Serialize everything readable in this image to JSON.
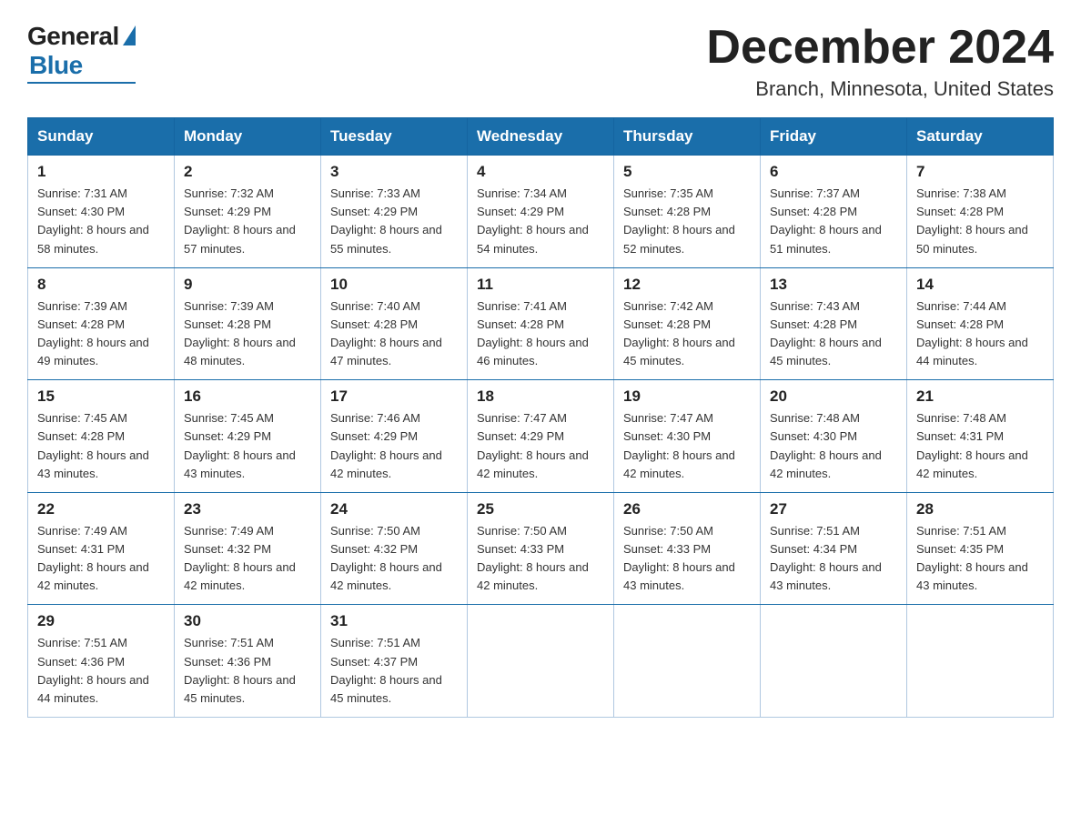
{
  "header": {
    "logo_general": "General",
    "logo_blue": "Blue",
    "month_title": "December 2024",
    "location": "Branch, Minnesota, United States"
  },
  "weekdays": [
    "Sunday",
    "Monday",
    "Tuesday",
    "Wednesday",
    "Thursday",
    "Friday",
    "Saturday"
  ],
  "weeks": [
    [
      {
        "day": "1",
        "sunrise": "Sunrise: 7:31 AM",
        "sunset": "Sunset: 4:30 PM",
        "daylight": "Daylight: 8 hours and 58 minutes."
      },
      {
        "day": "2",
        "sunrise": "Sunrise: 7:32 AM",
        "sunset": "Sunset: 4:29 PM",
        "daylight": "Daylight: 8 hours and 57 minutes."
      },
      {
        "day": "3",
        "sunrise": "Sunrise: 7:33 AM",
        "sunset": "Sunset: 4:29 PM",
        "daylight": "Daylight: 8 hours and 55 minutes."
      },
      {
        "day": "4",
        "sunrise": "Sunrise: 7:34 AM",
        "sunset": "Sunset: 4:29 PM",
        "daylight": "Daylight: 8 hours and 54 minutes."
      },
      {
        "day": "5",
        "sunrise": "Sunrise: 7:35 AM",
        "sunset": "Sunset: 4:28 PM",
        "daylight": "Daylight: 8 hours and 52 minutes."
      },
      {
        "day": "6",
        "sunrise": "Sunrise: 7:37 AM",
        "sunset": "Sunset: 4:28 PM",
        "daylight": "Daylight: 8 hours and 51 minutes."
      },
      {
        "day": "7",
        "sunrise": "Sunrise: 7:38 AM",
        "sunset": "Sunset: 4:28 PM",
        "daylight": "Daylight: 8 hours and 50 minutes."
      }
    ],
    [
      {
        "day": "8",
        "sunrise": "Sunrise: 7:39 AM",
        "sunset": "Sunset: 4:28 PM",
        "daylight": "Daylight: 8 hours and 49 minutes."
      },
      {
        "day": "9",
        "sunrise": "Sunrise: 7:39 AM",
        "sunset": "Sunset: 4:28 PM",
        "daylight": "Daylight: 8 hours and 48 minutes."
      },
      {
        "day": "10",
        "sunrise": "Sunrise: 7:40 AM",
        "sunset": "Sunset: 4:28 PM",
        "daylight": "Daylight: 8 hours and 47 minutes."
      },
      {
        "day": "11",
        "sunrise": "Sunrise: 7:41 AM",
        "sunset": "Sunset: 4:28 PM",
        "daylight": "Daylight: 8 hours and 46 minutes."
      },
      {
        "day": "12",
        "sunrise": "Sunrise: 7:42 AM",
        "sunset": "Sunset: 4:28 PM",
        "daylight": "Daylight: 8 hours and 45 minutes."
      },
      {
        "day": "13",
        "sunrise": "Sunrise: 7:43 AM",
        "sunset": "Sunset: 4:28 PM",
        "daylight": "Daylight: 8 hours and 45 minutes."
      },
      {
        "day": "14",
        "sunrise": "Sunrise: 7:44 AM",
        "sunset": "Sunset: 4:28 PM",
        "daylight": "Daylight: 8 hours and 44 minutes."
      }
    ],
    [
      {
        "day": "15",
        "sunrise": "Sunrise: 7:45 AM",
        "sunset": "Sunset: 4:28 PM",
        "daylight": "Daylight: 8 hours and 43 minutes."
      },
      {
        "day": "16",
        "sunrise": "Sunrise: 7:45 AM",
        "sunset": "Sunset: 4:29 PM",
        "daylight": "Daylight: 8 hours and 43 minutes."
      },
      {
        "day": "17",
        "sunrise": "Sunrise: 7:46 AM",
        "sunset": "Sunset: 4:29 PM",
        "daylight": "Daylight: 8 hours and 42 minutes."
      },
      {
        "day": "18",
        "sunrise": "Sunrise: 7:47 AM",
        "sunset": "Sunset: 4:29 PM",
        "daylight": "Daylight: 8 hours and 42 minutes."
      },
      {
        "day": "19",
        "sunrise": "Sunrise: 7:47 AM",
        "sunset": "Sunset: 4:30 PM",
        "daylight": "Daylight: 8 hours and 42 minutes."
      },
      {
        "day": "20",
        "sunrise": "Sunrise: 7:48 AM",
        "sunset": "Sunset: 4:30 PM",
        "daylight": "Daylight: 8 hours and 42 minutes."
      },
      {
        "day": "21",
        "sunrise": "Sunrise: 7:48 AM",
        "sunset": "Sunset: 4:31 PM",
        "daylight": "Daylight: 8 hours and 42 minutes."
      }
    ],
    [
      {
        "day": "22",
        "sunrise": "Sunrise: 7:49 AM",
        "sunset": "Sunset: 4:31 PM",
        "daylight": "Daylight: 8 hours and 42 minutes."
      },
      {
        "day": "23",
        "sunrise": "Sunrise: 7:49 AM",
        "sunset": "Sunset: 4:32 PM",
        "daylight": "Daylight: 8 hours and 42 minutes."
      },
      {
        "day": "24",
        "sunrise": "Sunrise: 7:50 AM",
        "sunset": "Sunset: 4:32 PM",
        "daylight": "Daylight: 8 hours and 42 minutes."
      },
      {
        "day": "25",
        "sunrise": "Sunrise: 7:50 AM",
        "sunset": "Sunset: 4:33 PM",
        "daylight": "Daylight: 8 hours and 42 minutes."
      },
      {
        "day": "26",
        "sunrise": "Sunrise: 7:50 AM",
        "sunset": "Sunset: 4:33 PM",
        "daylight": "Daylight: 8 hours and 43 minutes."
      },
      {
        "day": "27",
        "sunrise": "Sunrise: 7:51 AM",
        "sunset": "Sunset: 4:34 PM",
        "daylight": "Daylight: 8 hours and 43 minutes."
      },
      {
        "day": "28",
        "sunrise": "Sunrise: 7:51 AM",
        "sunset": "Sunset: 4:35 PM",
        "daylight": "Daylight: 8 hours and 43 minutes."
      }
    ],
    [
      {
        "day": "29",
        "sunrise": "Sunrise: 7:51 AM",
        "sunset": "Sunset: 4:36 PM",
        "daylight": "Daylight: 8 hours and 44 minutes."
      },
      {
        "day": "30",
        "sunrise": "Sunrise: 7:51 AM",
        "sunset": "Sunset: 4:36 PM",
        "daylight": "Daylight: 8 hours and 45 minutes."
      },
      {
        "day": "31",
        "sunrise": "Sunrise: 7:51 AM",
        "sunset": "Sunset: 4:37 PM",
        "daylight": "Daylight: 8 hours and 45 minutes."
      },
      null,
      null,
      null,
      null
    ]
  ]
}
